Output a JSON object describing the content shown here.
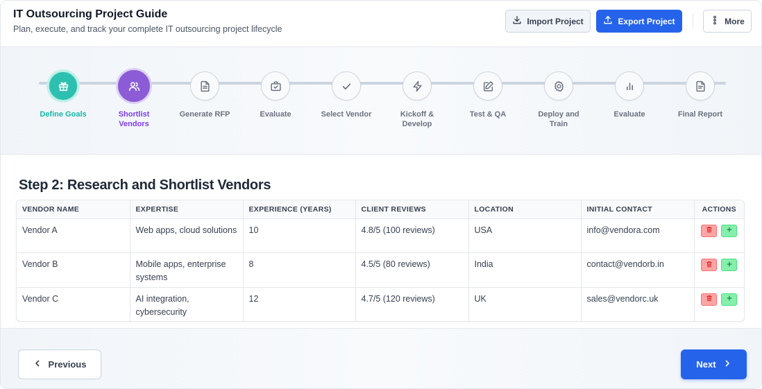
{
  "header": {
    "title": "IT Outsourcing Project Guide",
    "subtitle": "Plan, execute, and track your complete IT outsourcing project lifecycle",
    "import_label": "Import Project",
    "export_label": "Export Project",
    "more_label": "More"
  },
  "steps": [
    {
      "label": "Define Goals",
      "icon": "target-icon",
      "state": "done"
    },
    {
      "label": "Shortlist Vendors",
      "icon": "users-icon",
      "state": "active"
    },
    {
      "label": "Generate RFP",
      "icon": "document-icon",
      "state": "pending"
    },
    {
      "label": "Evaluate",
      "icon": "briefcase-check-icon",
      "state": "pending"
    },
    {
      "label": "Select Vendor",
      "icon": "check-icon",
      "state": "pending"
    },
    {
      "label": "Kickoff & Develop",
      "icon": "lightning-icon",
      "state": "pending"
    },
    {
      "label": "Test & QA",
      "icon": "edit-icon",
      "state": "pending"
    },
    {
      "label": "Deploy and Train",
      "icon": "gear-icon",
      "state": "pending"
    },
    {
      "label": "Evaluate",
      "icon": "bar-chart-icon",
      "state": "pending"
    },
    {
      "label": "Final Report",
      "icon": "report-icon",
      "state": "pending"
    }
  ],
  "main": {
    "section_title": "Step 2: Research and Shortlist Vendors",
    "table": {
      "columns": [
        "VENDOR NAME",
        "EXPERTISE",
        "EXPERIENCE (YEARS)",
        "CLIENT REVIEWS",
        "LOCATION",
        "INITIAL CONTACT",
        "ACTIONS"
      ],
      "rows": [
        {
          "name": "Vendor A",
          "expertise": "Web apps, cloud solutions",
          "experience": "10",
          "reviews": "4.8/5 (100 reviews)",
          "location": "USA",
          "contact": "info@vendora.com"
        },
        {
          "name": "Vendor B",
          "expertise": "Mobile apps, enterprise systems",
          "experience": "8",
          "reviews": "4.5/5 (80 reviews)",
          "location": "India",
          "contact": "contact@vendorb.in"
        },
        {
          "name": "Vendor C",
          "expertise": "AI integration, cybersecurity",
          "experience": "12",
          "reviews": "4.7/5 (120 reviews)",
          "location": "UK",
          "contact": "sales@vendorc.uk"
        }
      ]
    }
  },
  "footer": {
    "previous_label": "Previous",
    "next_label": "Next"
  },
  "colors": {
    "accent": "#2563eb",
    "done": "#2dbfb0",
    "active": "#8b5cd6",
    "delete": "#fca5a5",
    "add": "#86efac"
  }
}
